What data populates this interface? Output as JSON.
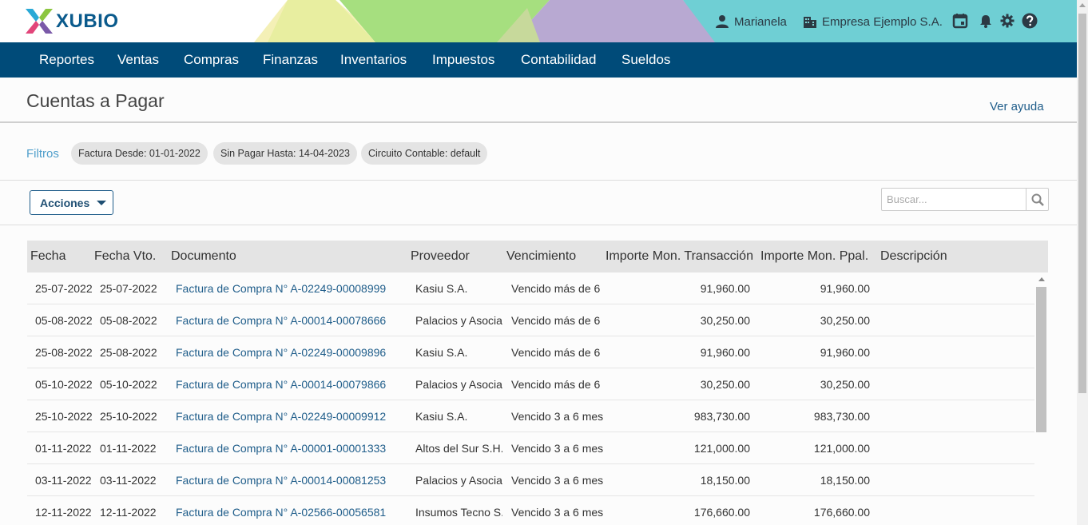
{
  "header": {
    "brand": "XUBIO",
    "user": "Marianela",
    "company": "Empresa Ejemplo S.A.",
    "icons": [
      "person-icon",
      "building-icon",
      "calendar-icon",
      "bell-icon",
      "gear-icon",
      "help-icon"
    ]
  },
  "nav": {
    "items": [
      "Reportes",
      "Ventas",
      "Compras",
      "Finanzas",
      "Inventarios",
      "Impuestos",
      "Contabilidad",
      "Sueldos"
    ]
  },
  "page": {
    "title": "Cuentas a Pagar",
    "help_link": "Ver ayuda"
  },
  "filters": {
    "label": "Filtros",
    "chips": [
      "Factura Desde:  01-01-2022",
      "Sin Pagar Hasta:  14-04-2023",
      "Circuito Contable:  default"
    ]
  },
  "toolbar": {
    "actions_label": "Acciones",
    "search_placeholder": "Buscar..."
  },
  "table": {
    "columns": [
      "Fecha",
      "Fecha Vto.",
      "Documento",
      "Proveedor",
      "Vencimiento",
      "Importe Mon. Transacción",
      "Importe Mon. Ppal.",
      "Descripción"
    ],
    "rows": [
      [
        "25-07-2022",
        "25-07-2022",
        "Factura de Compra N° A-02249-00008999",
        "Kasiu S.A.",
        "Vencido más de 6",
        "91,960.00",
        "91,960.00",
        ""
      ],
      [
        "05-08-2022",
        "05-08-2022",
        "Factura de Compra N° A-00014-00078666",
        "Palacios y Asocia",
        "Vencido más de 6",
        "30,250.00",
        "30,250.00",
        ""
      ],
      [
        "25-08-2022",
        "25-08-2022",
        "Factura de Compra N° A-02249-00009896",
        "Kasiu S.A.",
        "Vencido más de 6",
        "91,960.00",
        "91,960.00",
        ""
      ],
      [
        "05-10-2022",
        "05-10-2022",
        "Factura de Compra N° A-00014-00079866",
        "Palacios y Asocia",
        "Vencido más de 6",
        "30,250.00",
        "30,250.00",
        ""
      ],
      [
        "25-10-2022",
        "25-10-2022",
        "Factura de Compra N° A-02249-00009912",
        "Kasiu S.A.",
        "Vencido 3 a 6 mes",
        "983,730.00",
        "983,730.00",
        ""
      ],
      [
        "01-11-2022",
        "01-11-2022",
        "Factura de Compra N° A-00001-00001333",
        "Altos del Sur S.H.",
        "Vencido 3 a 6 mes",
        "121,000.00",
        "121,000.00",
        ""
      ],
      [
        "03-11-2022",
        "03-11-2022",
        "Factura de Compra N° A-00014-00081253",
        "Palacios y Asocia",
        "Vencido 3 a 6 mes",
        "18,150.00",
        "18,150.00",
        ""
      ],
      [
        "12-11-2022",
        "12-11-2022",
        "Factura de Compra N° A-02566-00056581",
        "Insumos Tecno S.",
        "Vencido 3 a 6 mes",
        "176,660.00",
        "176,660.00",
        ""
      ]
    ]
  },
  "colors": {
    "nav_bg": "#004b79",
    "brand": "#0a5a8c",
    "link": "#1f5d8a",
    "filters_label": "#4f9ecb",
    "header_band": "#6fcfd4"
  }
}
